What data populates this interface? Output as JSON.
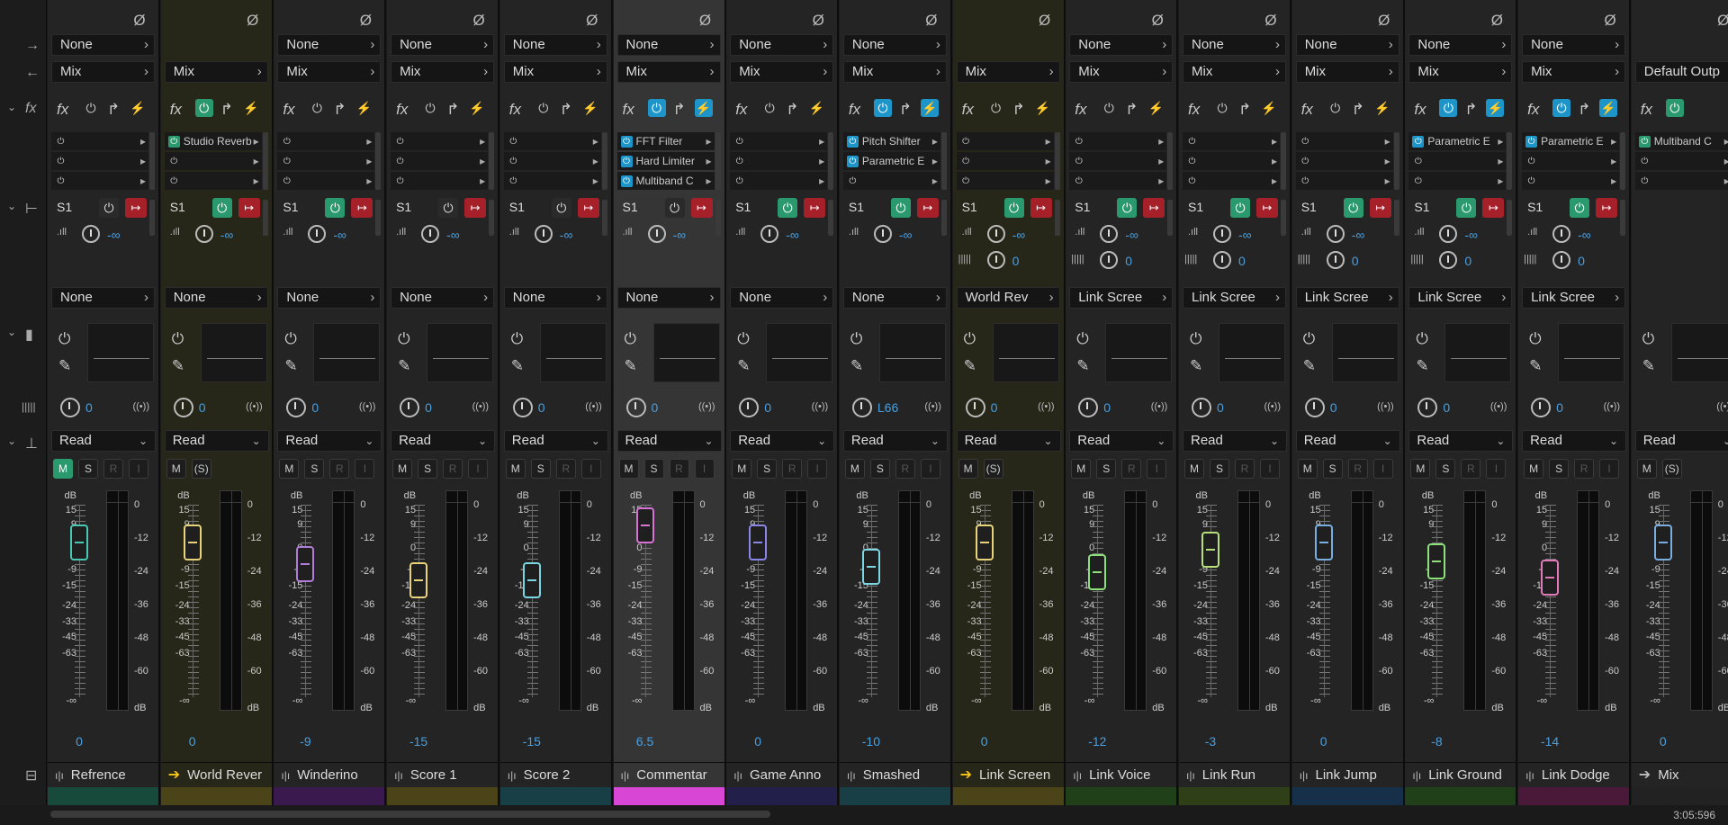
{
  "app": {
    "time": "3:05:596"
  },
  "gutter": {
    "input_icon": "→",
    "output_icon": "←",
    "fx_icon": "fx",
    "send_icon": "send-icon",
    "eq_icon": "eq-icon",
    "pan_icon": "pan-icon",
    "auto_icon": "automation-icon",
    "name_icon": "name-icon"
  },
  "colors": {
    "teal": "#2a9a6e",
    "blue": "#1e95c9",
    "red": "#a6202a",
    "value": "#49a0e0"
  },
  "tracks": [
    {
      "name": "Refrence",
      "icon": "waveform-icon",
      "input": "None",
      "output": "Mix",
      "fx_power": "off",
      "fx": [],
      "send": "None",
      "send_on": false,
      "send_extra": false,
      "pan": "0",
      "auto": "Read",
      "mute": true,
      "solo": "S",
      "fader": "0",
      "color": "#174a3a",
      "cap": "#49c9b4",
      "bg": "#242424"
    },
    {
      "name": "World Rever",
      "icon": "bus-icon",
      "input": "",
      "output": "Mix",
      "fx_power": "on",
      "fx": [
        {
          "n": "Studio Reverb",
          "s": "grn"
        }
      ],
      "send": "None",
      "send_on": true,
      "send_extra": false,
      "pan": "0",
      "auto": "Read",
      "mute": false,
      "solo": "(S)",
      "fader": "0",
      "color": "#4a4418",
      "cap": "#e8d27a",
      "bg": "#262619"
    },
    {
      "name": "Winderino",
      "icon": "waveform-icon",
      "input": "None",
      "output": "Mix",
      "fx_power": "off",
      "fx": [],
      "send": "None",
      "send_on": true,
      "send_extra": false,
      "pan": "0",
      "auto": "Read",
      "mute": false,
      "solo": "S",
      "fader": "-9",
      "color": "#3a1a4e",
      "cap": "#b07ed8",
      "bg": "#242424"
    },
    {
      "name": "Score 1",
      "icon": "waveform-icon",
      "input": "None",
      "output": "Mix",
      "fx_power": "off",
      "fx": [],
      "send": "None",
      "send_on": false,
      "send_extra": false,
      "pan": "0",
      "auto": "Read",
      "mute": false,
      "solo": "S",
      "fader": "-15",
      "color": "#4a4418",
      "cap": "#e8d27a",
      "bg": "#242424"
    },
    {
      "name": "Score 2",
      "icon": "waveform-icon",
      "input": "None",
      "output": "Mix",
      "fx_power": "off",
      "fx": [],
      "send": "None",
      "send_on": false,
      "send_extra": false,
      "pan": "0",
      "auto": "Read",
      "mute": false,
      "solo": "S",
      "fader": "-15",
      "color": "#173f45",
      "cap": "#7ad6e0",
      "bg": "#242424"
    },
    {
      "name": "Commentar",
      "icon": "waveform-icon",
      "input": "None",
      "output": "Mix",
      "fx_power": "blue",
      "fx": [
        {
          "n": "FFT Filter",
          "s": "on"
        },
        {
          "n": "Hard Limiter",
          "s": "on"
        },
        {
          "n": "Multiband C",
          "s": "on"
        }
      ],
      "send": "None",
      "send_on": false,
      "send_extra": false,
      "pan": "0",
      "auto": "Read",
      "mute": false,
      "solo": "S",
      "fader": "6.5",
      "color": "#d846d6",
      "cap": "#d873d6",
      "bg": "#353535",
      "sel": true
    },
    {
      "name": "Game Anno",
      "icon": "waveform-icon",
      "input": "None",
      "output": "Mix",
      "fx_power": "off",
      "fx": [],
      "send": "None",
      "send_on": true,
      "send_extra": false,
      "pan": "0",
      "auto": "Read",
      "mute": false,
      "solo": "S",
      "fader": "0",
      "color": "#22204a",
      "cap": "#8a86e8",
      "bg": "#242424"
    },
    {
      "name": "Smashed",
      "icon": "waveform-icon",
      "input": "None",
      "output": "Mix",
      "fx_power": "blue",
      "fx": [
        {
          "n": "Pitch Shifter",
          "s": "on"
        },
        {
          "n": "Parametric E",
          "s": "on"
        }
      ],
      "send": "None",
      "send_on": true,
      "send_extra": false,
      "pan": "L66",
      "auto": "Read",
      "mute": false,
      "solo": "S",
      "fader": "-10",
      "color": "#173f45",
      "cap": "#7ad6e0",
      "bg": "#242424"
    },
    {
      "name": "Link Screen",
      "icon": "bus-icon",
      "input": "",
      "output": "Mix",
      "fx_power": "off",
      "fx": [],
      "send": "World Rev",
      "send_on": true,
      "send_extra": true,
      "pan": "0",
      "auto": "Read",
      "mute": false,
      "solo": "(S)",
      "fader": "0",
      "color": "#4a4418",
      "cap": "#e8d27a",
      "bg": "#262619"
    },
    {
      "name": "Link Voice",
      "icon": "waveform-icon",
      "input": "None",
      "output": "Mix",
      "fx_power": "off",
      "fx": [],
      "send": "Link Scree",
      "send_on": true,
      "send_extra": true,
      "pan": "0",
      "auto": "Read",
      "mute": false,
      "solo": "S",
      "fader": "-12",
      "color": "#1f4018",
      "cap": "#8ee07a",
      "bg": "#242424"
    },
    {
      "name": "Link Run",
      "icon": "waveform-icon",
      "input": "None",
      "output": "Mix",
      "fx_power": "off",
      "fx": [],
      "send": "Link Scree",
      "send_on": true,
      "send_extra": true,
      "pan": "0",
      "auto": "Read",
      "mute": false,
      "solo": "S",
      "fader": "-3",
      "color": "#2f4018",
      "cap": "#b8e07a",
      "bg": "#242424"
    },
    {
      "name": "Link Jump",
      "icon": "waveform-icon",
      "input": "None",
      "output": "Mix",
      "fx_power": "off",
      "fx": [],
      "send": "Link Scree",
      "send_on": true,
      "send_extra": true,
      "pan": "0",
      "auto": "Read",
      "mute": false,
      "solo": "S",
      "fader": "0",
      "color": "#17304a",
      "cap": "#7aaee0",
      "bg": "#242424"
    },
    {
      "name": "Link Ground",
      "icon": "waveform-icon",
      "input": "None",
      "output": "Mix",
      "fx_power": "blue",
      "fx": [
        {
          "n": "Parametric E",
          "s": "on"
        }
      ],
      "send": "Link Scree",
      "send_on": true,
      "send_extra": true,
      "pan": "0",
      "auto": "Read",
      "mute": false,
      "solo": "S",
      "fader": "-8",
      "color": "#1f4018",
      "cap": "#8ee07a",
      "bg": "#242424"
    },
    {
      "name": "Link Dodge",
      "icon": "waveform-icon",
      "input": "None",
      "output": "Mix",
      "fx_power": "blue",
      "fx": [
        {
          "n": "Parametric E",
          "s": "on"
        }
      ],
      "send": "Link Scree",
      "send_on": true,
      "send_extra": true,
      "pan": "0",
      "auto": "Read",
      "mute": false,
      "solo": "S",
      "fader": "-14",
      "color": "#4a1838",
      "cap": "#e07ab8",
      "bg": "#242424"
    },
    {
      "name": "Mix",
      "icon": "master-icon",
      "input": "",
      "output": "Default Outp",
      "fx_power": "on",
      "fx": [
        {
          "n": "Multiband C",
          "s": "grn"
        }
      ],
      "send": "",
      "send_on": false,
      "send_extra": false,
      "pan": "",
      "auto": "Read",
      "mute": false,
      "solo": "(S)",
      "fader": "0",
      "color": "#222222",
      "cap": "#7aaee0",
      "bg": "#242424",
      "master": true
    }
  ],
  "scale_left": [
    "dB",
    "15",
    "9",
    "0",
    "-9",
    "-15",
    "-24",
    "-33",
    "-45",
    "-63",
    "-∞"
  ],
  "scale_right": [
    "0",
    "-12",
    "-24",
    "-36",
    "-48",
    "-60",
    "dB"
  ]
}
